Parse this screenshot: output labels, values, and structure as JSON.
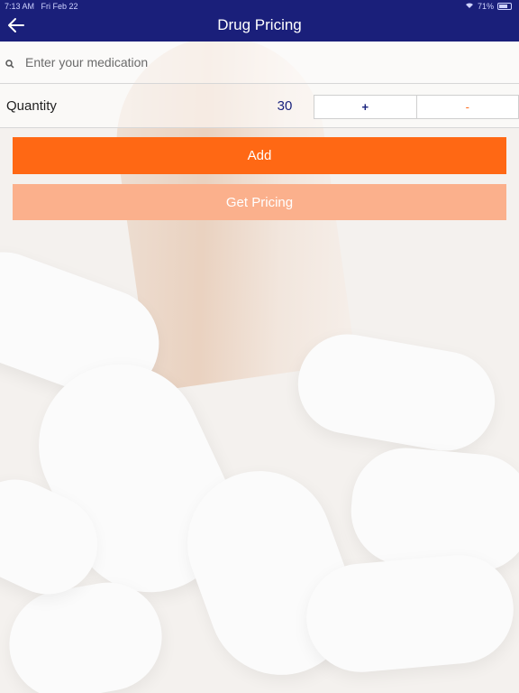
{
  "status_bar": {
    "time": "7:13 AM",
    "date": "Fri Feb 22",
    "battery": "71%",
    "wifi_icon": "wifi-icon",
    "battery_icon": "battery-icon"
  },
  "navbar": {
    "title": "Drug Pricing",
    "back_icon": "back-arrow-icon",
    "background_color": "#1a1f7a"
  },
  "search": {
    "placeholder": "Enter your medication",
    "value": "",
    "icon": "search-icon"
  },
  "quantity": {
    "label": "Quantity",
    "value": "30",
    "increment_label": "+",
    "decrement_label": "-"
  },
  "buttons": {
    "add_label": "Add",
    "get_pricing_label": "Get Pricing",
    "primary_color": "#ff6814",
    "disabled_color": "#fbb08c"
  }
}
